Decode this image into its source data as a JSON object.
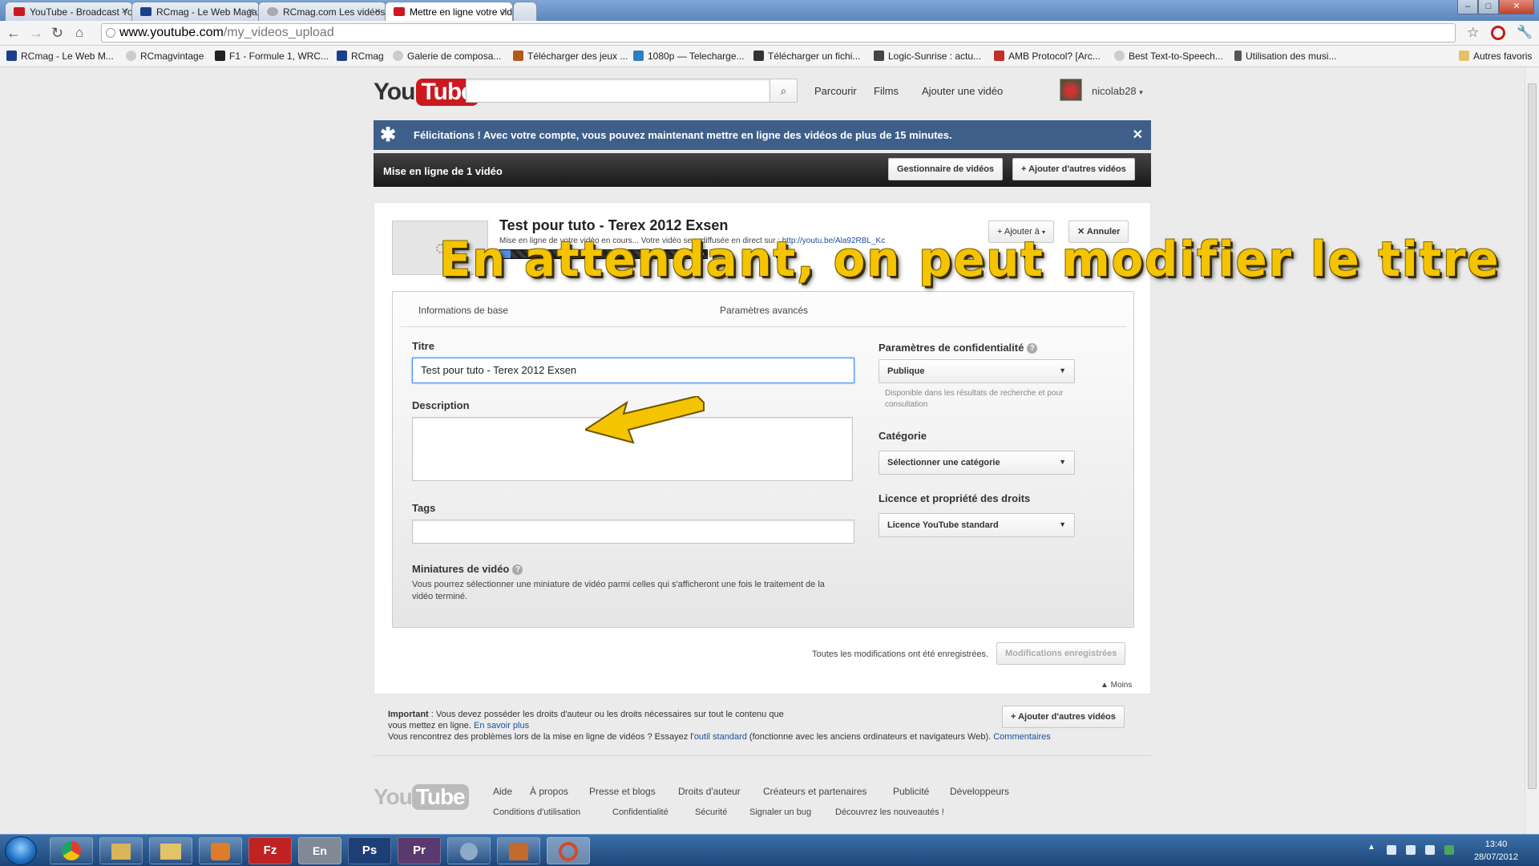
{
  "browser": {
    "tabs": [
      {
        "label": "YouTube - Broadcast Yourself",
        "icon": "youtube-favicon",
        "color": "#cc181e"
      },
      {
        "label": "RCmag - Le Web Magazine",
        "icon": "rcmag-favicon",
        "color": "#1b3f8a"
      },
      {
        "label": "RCmag.com Les vidéos.",
        "icon": "globe-favicon",
        "color": "#888888"
      },
      {
        "label": "Mettre en ligne votre vidéo",
        "icon": "youtube-favicon",
        "color": "#cc181e"
      }
    ],
    "url_host": "www.youtube.com",
    "url_path": "/my_videos_upload",
    "bookmarks": [
      {
        "label": "RCmag - Le Web M...",
        "color": "#1b3f8a"
      },
      {
        "label": "RCmagvintage",
        "color": "#999999"
      },
      {
        "label": "F1 - Formule 1, WRC...",
        "color": "#222222"
      },
      {
        "label": "RCmag",
        "color": "#1b3f8a"
      },
      {
        "label": "Galerie de composa...",
        "color": "#999999"
      },
      {
        "label": "Télécharger des jeux ...",
        "color": "#b05a1a"
      },
      {
        "label": "1080p — Telecharge...",
        "color": "#2d7fbf"
      },
      {
        "label": "Télécharger un fichi...",
        "color": "#333333"
      },
      {
        "label": "Logic-Sunrise : actu...",
        "color": "#444444"
      },
      {
        "label": "AMB Protocol? [Arc...",
        "color": "#c0302a"
      },
      {
        "label": "Best Text-to-Speech...",
        "color": "#999999"
      },
      {
        "label": "Utilisation des musi...",
        "color": "#555555"
      }
    ],
    "other_bookmarks": "Autres favoris"
  },
  "header": {
    "logo_you": "You",
    "logo_tube": "Tube",
    "search_placeholder": "",
    "links": [
      "Parcourir",
      "Films",
      "Ajouter une vidéo"
    ],
    "username": "nicolab28"
  },
  "banner": {
    "message": "Félicitations ! Avec votre compte, vous pouvez maintenant mettre en ligne des vidéos de plus de 15 minutes.",
    "close": "✕"
  },
  "upload_bar": {
    "title": "Mise en ligne de 1 vidéo",
    "manager_btn": "Gestionnaire de vidéos",
    "add_more_btn": "Ajouter d'autres vidéos"
  },
  "video": {
    "title": "Test pour tuto - Terex 2012 Exsen",
    "status": "Mise en ligne de votre vidéo en cours... Votre vidéo sera diffusée en direct sur :",
    "link": "http://youtu.be/Ala92RBL_Kc",
    "progress_label": "5 %",
    "progress": 0.05,
    "add_to_btn": "Ajouter à",
    "cancel_btn": "Annuler"
  },
  "form": {
    "tabs": [
      "Informations de base",
      "Paramètres avancés"
    ],
    "title_label": "Titre",
    "title_value": "Test pour tuto - Terex 2012 Exsen",
    "description_label": "Description",
    "tags_label": "Tags",
    "thumbs_label": "Miniatures de vidéo",
    "thumbs_text": "Vous pourrez sélectionner une miniature de vidéo parmi celles qui s'afficheront une fois le traitement de la vidéo terminé.",
    "privacy_label": "Paramètres de confidentialité",
    "privacy_value": "Publique",
    "privacy_hint": "Disponible dans les résultats de recherche et pour consultation",
    "category_label": "Catégorie",
    "category_value": "Sélectionner une catégorie",
    "license_label": "Licence et propriété des droits",
    "license_value": "Licence YouTube standard",
    "saved_text": "Toutes les modifications ont été enregistrées.",
    "saved_btn": "Modifications enregistrées",
    "less_link": "▲ Moins"
  },
  "annotation": {
    "text": "En attendant, on peut modifier le titre",
    "color": "#f5c400"
  },
  "notice": {
    "important": "Important",
    "text1": " : Vous devez posséder les droits d'auteur ou les droits nécessaires sur tout le contenu que vous mettez en ligne.",
    "learn_more": "En savoir plus",
    "text2": "Vous rencontrez des problèmes lors de la mise en ligne de vidéos ? Essayez l'",
    "standard_tool": "outil standard",
    "text3": " (fonctionne avec les anciens ordinateurs et navigateurs Web).",
    "comments": "Commentaires",
    "add_more_btn": "Ajouter d'autres vidéos"
  },
  "footer": {
    "links_row1": [
      "Aide",
      "À propos",
      "Presse et blogs",
      "Droits d'auteur",
      "Créateurs et partenaires",
      "Publicité",
      "Développeurs"
    ],
    "links_row2": [
      "Conditions d'utilisation",
      "Confidentialité",
      "Sécurité",
      "Signaler un bug",
      "Découvrez les nouveautés !"
    ]
  },
  "taskbar": {
    "apps": [
      {
        "name": "chrome",
        "label": "",
        "color": "#e33b2e"
      },
      {
        "name": "explorer-window",
        "label": "",
        "color": "#d9b45a"
      },
      {
        "name": "folder",
        "label": "",
        "color": "#e3c36a"
      },
      {
        "name": "media-player",
        "label": "",
        "color": "#e07b2a"
      },
      {
        "name": "filezilla",
        "label": "Fz",
        "color": "#bf2222"
      },
      {
        "name": "language",
        "label": "En",
        "color": "#7f8a96"
      },
      {
        "name": "photoshop",
        "label": "Ps",
        "color": "#1d3f75"
      },
      {
        "name": "premiere",
        "label": "Pr",
        "color": "#5a3a6e"
      },
      {
        "name": "paint-app",
        "label": "",
        "color": "#8fa9c8"
      },
      {
        "name": "sound-app",
        "label": "",
        "color": "#c46a2e"
      },
      {
        "name": "capture-app",
        "label": "",
        "color": "#d24a2a"
      }
    ],
    "time": "13:40",
    "date": "28/07/2012"
  }
}
